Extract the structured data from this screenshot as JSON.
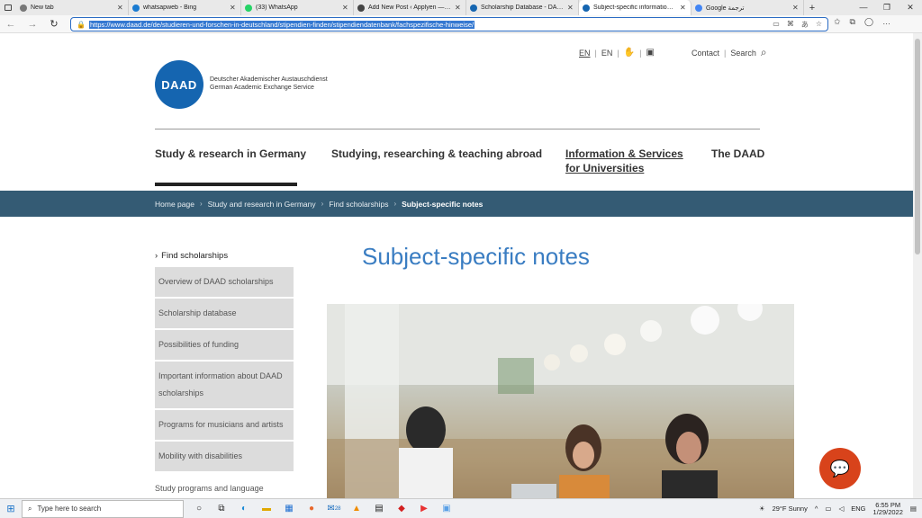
{
  "browser": {
    "tabs": [
      {
        "title": "New tab",
        "color": "#777777",
        "active": false
      },
      {
        "title": "whatsapweb - Bing",
        "color": "#1a7bd1",
        "active": false
      },
      {
        "title": "(33) WhatsApp",
        "color": "#25d366",
        "active": false
      },
      {
        "title": "Add New Post ‹ Applyen — Wo…",
        "color": "#444444",
        "active": false
      },
      {
        "title": "Scholarship Database - DAAD - …",
        "color": "#1565b0",
        "active": false
      },
      {
        "title": "Subject-specific information - D…",
        "color": "#1565b0",
        "active": true
      },
      {
        "title": "Google ترجمة",
        "color": "#4285f4",
        "active": false
      }
    ],
    "url": "https://www.daad.de/de/studieren-und-forschen-in-deutschland/stipendien-finden/stipendiendatenbank/fachspezifische-hinweise/"
  },
  "header": {
    "lang_current": "EN",
    "lang_other": "EN",
    "contact": "Contact",
    "search": "Search",
    "org_line1": "Deutscher Akademischer Austauschdienst",
    "org_line2": "German Academic Exchange Service",
    "logo_text": "DAAD",
    "brand_color": "#1565b0"
  },
  "nav": {
    "study": "Study & research in Germany",
    "abroad": "Studying, researching & teaching abroad",
    "info_line1": "Information & Services",
    "info_line2": "for Universities",
    "daad": "The DAAD"
  },
  "breadcrumb": {
    "items": [
      "Home page",
      "Study and research in Germany",
      "Find scholarships"
    ],
    "current": "Subject-specific notes"
  },
  "sidebar": {
    "heading": "Find scholarships",
    "items": [
      "Overview of DAAD scholarships",
      "Scholarship database",
      "Possibilities of funding",
      "Important information about DAAD scholarships",
      "Programs for musicians and artists",
      "Mobility with disabilities"
    ],
    "plain": "Study programs and language courses"
  },
  "main": {
    "title": "Subject-specific notes"
  },
  "taskbar": {
    "search_placeholder": "Type here to search",
    "weather": "29°F  Sunny",
    "lang": "ENG",
    "time": "6:55 PM",
    "date": "1/29/2022",
    "badge": "28"
  }
}
